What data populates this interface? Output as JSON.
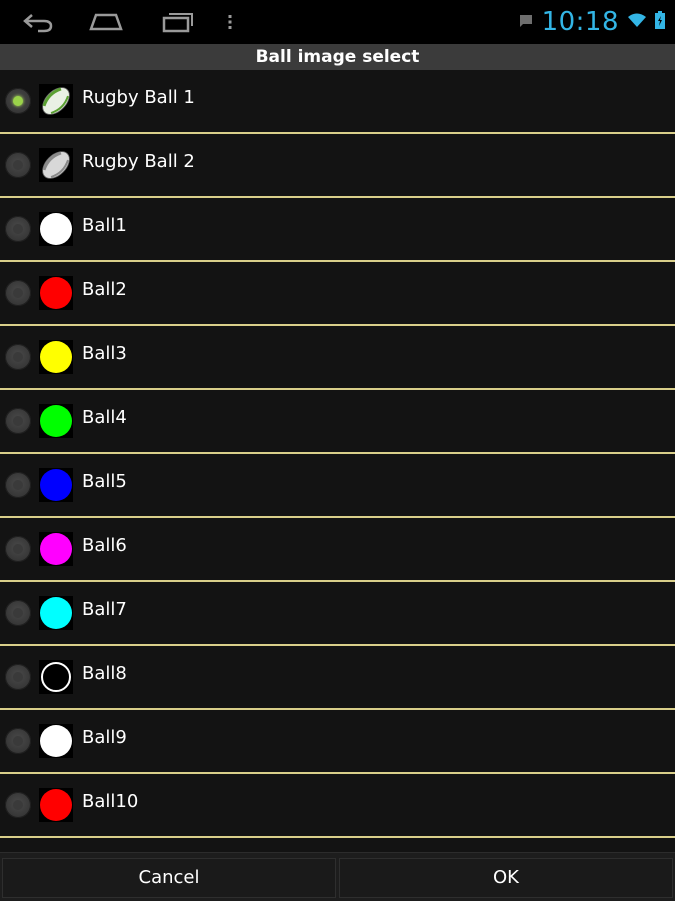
{
  "status_bar": {
    "clock": "10:18",
    "nav": {
      "back_icon": "back-arrow-icon",
      "home_icon": "home-icon",
      "recents_icon": "recents-icon",
      "menu_icon": "overflow-menu-icon"
    },
    "icons": [
      "notification-icon",
      "wifi-icon",
      "battery-icon"
    ],
    "accent_color": "#33b5e5"
  },
  "dialog": {
    "title": "Ball image select",
    "items": [
      {
        "label": "Rugby Ball 1",
        "image": "rugby-ball-green",
        "selected": true
      },
      {
        "label": "Rugby Ball 2",
        "image": "rugby-ball-grey",
        "selected": false
      },
      {
        "label": "Ball1",
        "image": "ball",
        "color": "#ffffff",
        "selected": false
      },
      {
        "label": "Ball2",
        "image": "ball",
        "color": "#ff0000",
        "selected": false
      },
      {
        "label": "Ball3",
        "image": "ball",
        "color": "#ffff00",
        "selected": false
      },
      {
        "label": "Ball4",
        "image": "ball",
        "color": "#00ff00",
        "selected": false
      },
      {
        "label": "Ball5",
        "image": "ball",
        "color": "#0000ff",
        "selected": false
      },
      {
        "label": "Ball6",
        "image": "ball",
        "color": "#ff00ff",
        "selected": false
      },
      {
        "label": "Ball7",
        "image": "ball",
        "color": "#00ffff",
        "selected": false
      },
      {
        "label": "Ball8",
        "image": "ball-outline",
        "color": "#000000",
        "selected": false
      },
      {
        "label": "Ball9",
        "image": "ball",
        "color": "#ffffff",
        "selected": false
      },
      {
        "label": "Ball10",
        "image": "ball",
        "color": "#ff0000",
        "selected": false
      },
      {
        "label": "",
        "image": "ball",
        "color": "#6b6b00",
        "selected": false
      }
    ],
    "cancel_label": "Cancel",
    "ok_label": "OK",
    "divider_color": "#d9cf8a",
    "radio_checked_color": "#9ad24a"
  }
}
